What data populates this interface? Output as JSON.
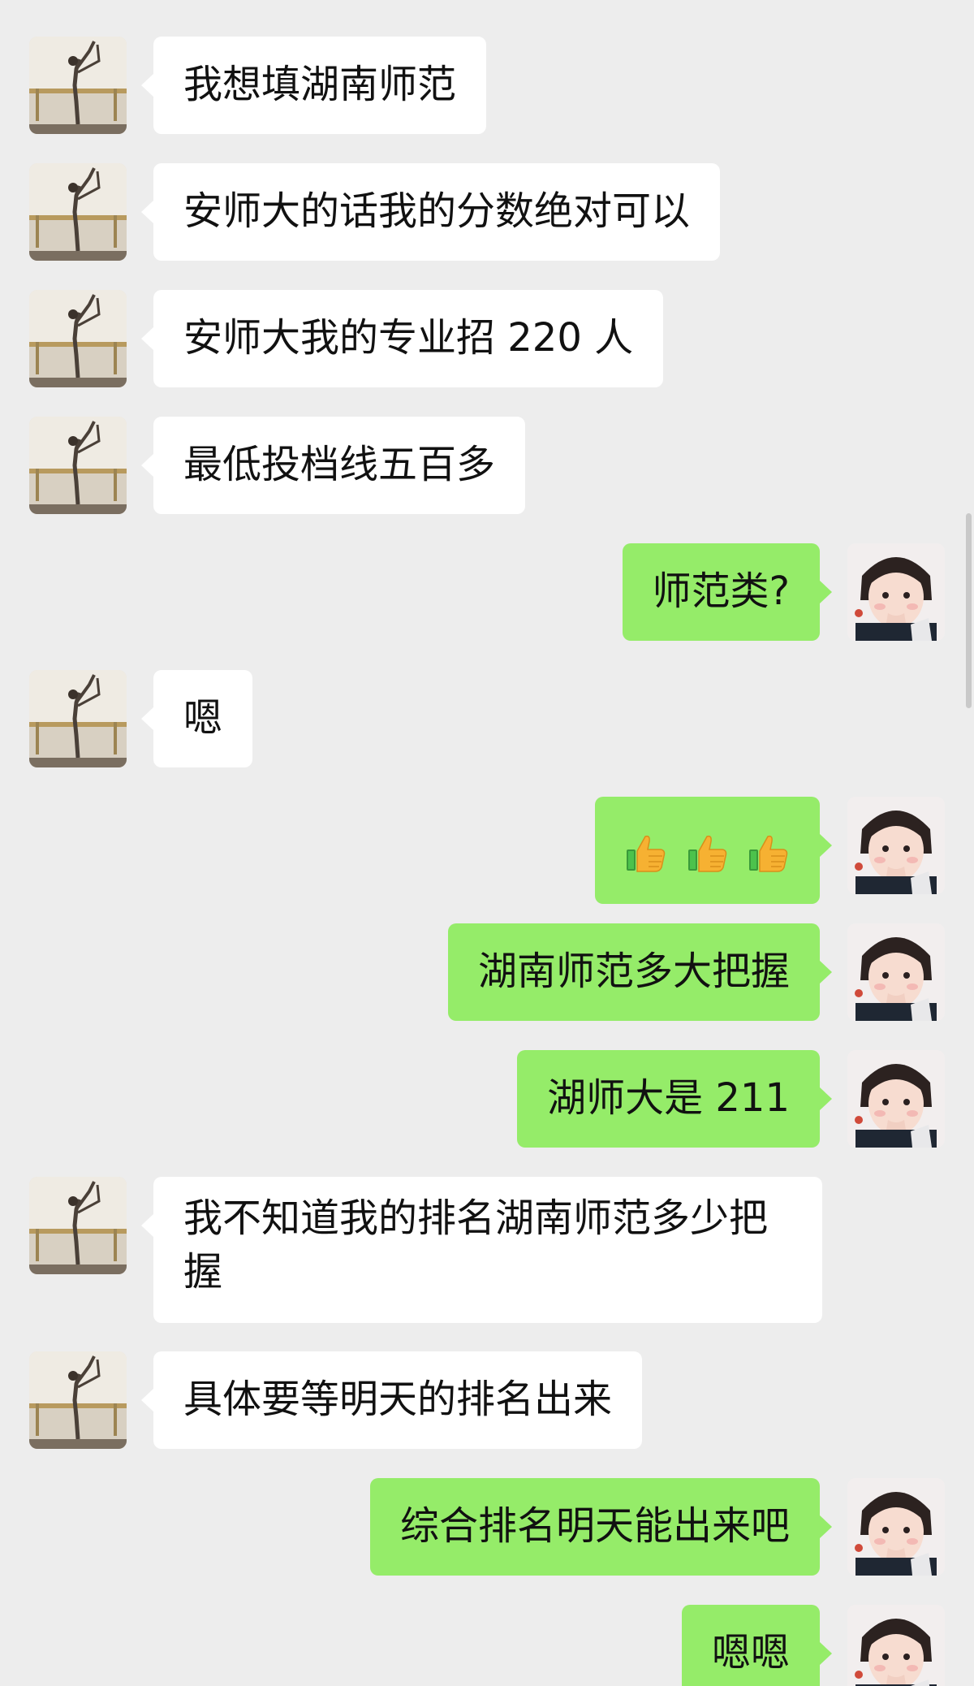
{
  "chat": {
    "colors": {
      "background": "#ededed",
      "incoming_bubble": "#ffffff",
      "outgoing_bubble": "#95ec69"
    },
    "messages": [
      {
        "side": "left",
        "text": "我想填湖南师范"
      },
      {
        "side": "left",
        "text": "安师大的话我的分数绝对可以"
      },
      {
        "side": "left",
        "text": "安师大我的专业招 220 人"
      },
      {
        "side": "left",
        "text": "最低投档线五百多"
      },
      {
        "side": "right",
        "text": "师范类?"
      },
      {
        "side": "left",
        "text": "嗯"
      },
      {
        "side": "right",
        "emoji": [
          "thumbs-up-icon",
          "thumbs-up-icon",
          "thumbs-up-icon"
        ]
      },
      {
        "side": "right",
        "text": "湖南师范多大把握"
      },
      {
        "side": "right",
        "text": "湖师大是 211"
      },
      {
        "side": "left",
        "text": "我不知道我的排名湖南师范多少把握"
      },
      {
        "side": "left",
        "text": "具体要等明天的排名出来"
      },
      {
        "side": "right",
        "text": "综合排名明天能出来吧"
      },
      {
        "side": "right",
        "text": "嗯嗯"
      }
    ]
  }
}
